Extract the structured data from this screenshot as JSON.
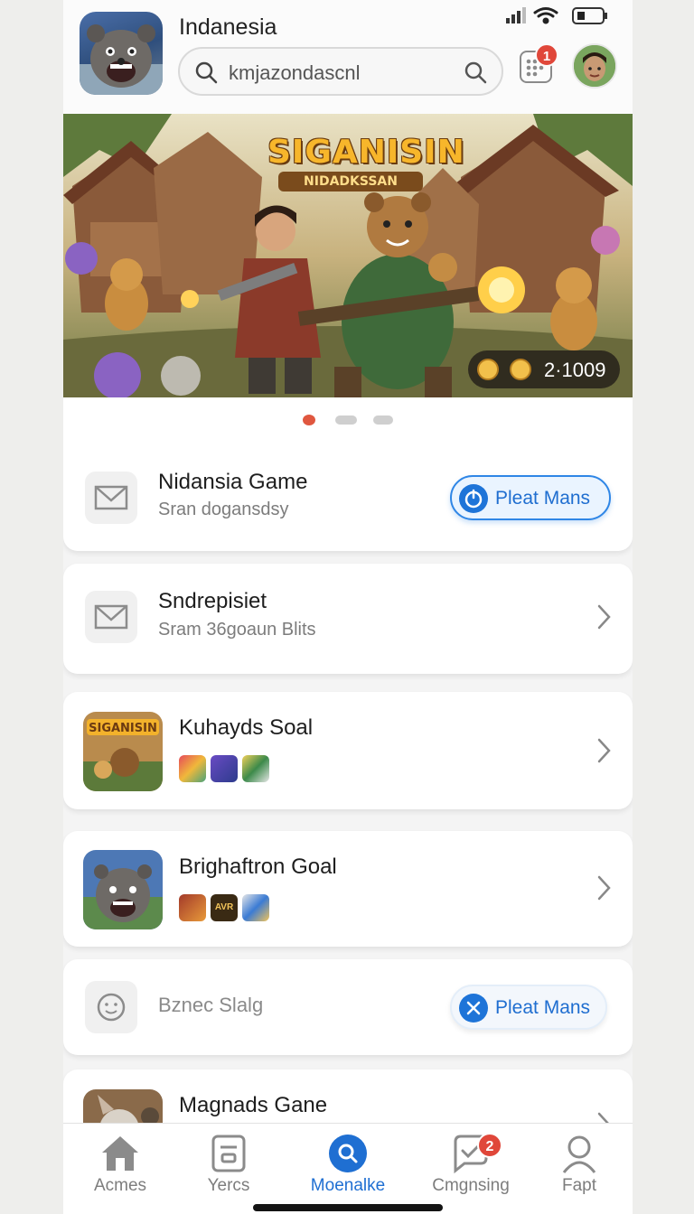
{
  "header": {
    "app_title": "Indanesia",
    "search_value": "kmjazondascnl",
    "notification_count": "1"
  },
  "banner": {
    "title": "SIGANISIN",
    "subtitle": "NIDADKSSAN",
    "counter": "2·1009",
    "carousel_dots": 3,
    "active_dot": 0
  },
  "cards": [
    {
      "title": "Nidansia Game",
      "subtitle": "Sran dogansdsy",
      "button_label": "Pleat Mans"
    },
    {
      "title": "Sndrepisiet",
      "subtitle": "Sram 36goaun Blits"
    },
    {
      "title": "Kuhayds Soal"
    },
    {
      "title": "Brighaftron Goal"
    },
    {
      "title": "Bznec Slalg",
      "button_label": "Pleat Mans"
    },
    {
      "title": "Magnads Gane"
    }
  ],
  "thumb_labels": {
    "kuhayds": "SIGANISIN",
    "brighaftron_tile": "AVR"
  },
  "nav": {
    "items": [
      {
        "label": "Acmes",
        "icon": "home-icon"
      },
      {
        "label": "Yercs",
        "icon": "document-icon"
      },
      {
        "label": "Moenalke",
        "icon": "search-icon",
        "active": true
      },
      {
        "label": "Cmgnsing",
        "icon": "chat-check-icon",
        "badge": "2"
      },
      {
        "label": "Fapt",
        "icon": "person-icon"
      }
    ]
  },
  "colors": {
    "accent": "#1f6fd2",
    "badge": "#e0473a",
    "inactive_dot": "#cfcfcf",
    "active_dot": "#e0573f"
  }
}
